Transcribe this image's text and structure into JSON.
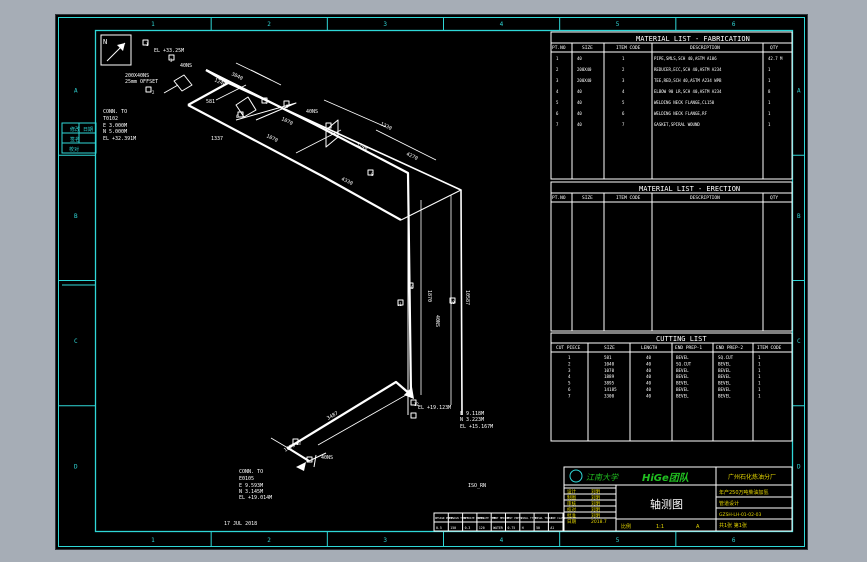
{
  "zone_numbers": [
    "1",
    "2",
    "3",
    "4",
    "5",
    "6"
  ],
  "zone_letters": [
    "A",
    "B",
    "C",
    "D"
  ],
  "north": "N",
  "fabrication": {
    "title": "MATERIAL LIST - FABRICATION",
    "headers": [
      "PT.NO",
      "SIZE",
      "ITEM CODE",
      "DESCRIPTION",
      "QTY"
    ],
    "rows": [
      [
        "1",
        "40",
        "1",
        "PIPE,SMLS,SCH 40,ASTM A106",
        "42.7 M"
      ],
      [
        "2",
        "200X40",
        "2",
        "REDUCER,ECC,SCH 40,ASTM A234",
        "1"
      ],
      [
        "3",
        "200X40",
        "3",
        "TEE,RED,SCH 40,ASTM A234 WPB",
        "1"
      ],
      [
        "4",
        "40",
        "4",
        "ELBOW 90 LR,SCH 40,ASTM A234",
        "8"
      ],
      [
        "5",
        "40",
        "5",
        "WELDING NECK FLANGE,CL150",
        "1"
      ],
      [
        "6",
        "40",
        "6",
        "WELDING NECK FLANGE,RF",
        "1"
      ],
      [
        "7",
        "40",
        "7",
        "GASKET,SPIRAL WOUND",
        "1"
      ]
    ]
  },
  "erection": {
    "title": "MATERIAL LIST - ERECTION",
    "headers": [
      "PT.NO",
      "SIZE",
      "ITEM CODE",
      "DESCRIPTION",
      "QTY"
    ]
  },
  "cutting": {
    "title": "CUTTING LIST",
    "headers": [
      "CUT PIECE",
      "SIZE",
      "LENGTH",
      "END PREP-1",
      "END PREP-2",
      "ITEM CODE"
    ],
    "rows": [
      [
        "1",
        "581",
        "40",
        "BEVEL",
        "SQ.CUT",
        "1"
      ],
      [
        "2",
        "1040",
        "40",
        "SQ.CUT",
        "BEVEL",
        "1"
      ],
      [
        "3",
        "1070",
        "40",
        "BEVEL",
        "BEVEL",
        "1"
      ],
      [
        "4",
        "1889",
        "40",
        "BEVEL",
        "BEVEL",
        "1"
      ],
      [
        "5",
        "3895",
        "40",
        "BEVEL",
        "BEVEL",
        "1"
      ],
      [
        "6",
        "14185",
        "40",
        "BEVEL",
        "BEVEL",
        "1"
      ],
      [
        "7",
        "3300",
        "40",
        "BEVEL",
        "BEVEL",
        "1"
      ]
    ]
  },
  "title_block": {
    "school": "江南大学",
    "team": "HiGe团队",
    "factory": "广州石化炼油分厂",
    "project": "年产250万吨柴油加氢",
    "design": "管道设计",
    "drawing_name": "轴测图",
    "drawing_no": "GZSH-LH-01-02-03",
    "sheet": "共1张 第1张",
    "scale_label": "比例",
    "scale": "1:1",
    "rev": "A",
    "signs": [
      "设计",
      "制图",
      "审核",
      "校对",
      "批准",
      "日期"
    ],
    "names": [
      "刘明",
      "刘明",
      "刘明",
      "刘明",
      "刘明",
      "2018.7"
    ]
  },
  "small_table": {
    "headers": [
      "DESIGN PRESS",
      "DESIGN TEMP",
      "OPERATE PRESS",
      "OPERATE TEMP",
      "TEST MEDIUM",
      "TEST PRESS",
      "INSUL TYPE",
      "INSUL THICK",
      "LINE CLASS"
    ],
    "values": [
      "0.5",
      "150",
      "0.3",
      "120",
      "WATER",
      "0.75",
      "H",
      "50",
      "A1"
    ]
  },
  "left_box": [
    "修改",
    "日期",
    "签名",
    "校对"
  ],
  "conn_top": [
    "CONN. TO",
    "T0102",
    "E 3.000M",
    "N 5.000M",
    "EL +32.391M"
  ],
  "conn_bottom": [
    "CONN. TO",
    "E0105",
    "E 9.593M",
    "N 3.145M",
    "EL +19.014M"
  ],
  "end_mid": [
    "E 9.118M",
    "N 3.223M",
    "EL +15.167M"
  ],
  "el_top": "EL +33.25M",
  "offset_note": [
    "200X40NS",
    "25mm OFFSET"
  ],
  "el_lower": "EL +19.123M",
  "dims": [
    "1240",
    "3040",
    "1337",
    "1070",
    "4270",
    "1070",
    "4330",
    "10587",
    "1870",
    "3487",
    "1075",
    "1330",
    "3240",
    "581",
    "40NS",
    "40NS",
    "40NS",
    "40NS"
  ],
  "date": "17 JUL 2018",
  "iso_label": "ISO_RN",
  "weld_markers": [
    "1",
    "2",
    "3",
    "4",
    "5",
    "6",
    "7",
    "8",
    "9",
    "10",
    "11",
    "12",
    "13"
  ],
  "colors": {
    "line": "#ffffff",
    "frame": "#2fd7d7",
    "bg": "#000000",
    "chrome": "#a6adb6"
  }
}
